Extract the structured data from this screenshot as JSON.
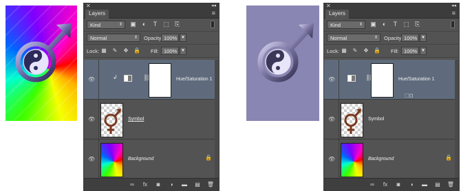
{
  "panels": [
    {
      "tab": "Layers",
      "kind_filter": "Kind",
      "blend_mode": "Normal",
      "opacity_label": "Opacity:",
      "opacity_value": "100%",
      "lock_label": "Lock:",
      "fill_label": "Fill:",
      "fill_value": "100%",
      "layers": [
        {
          "name": "Hue/Saturation 1",
          "type": "adjustment",
          "selected": true,
          "clipped": true
        },
        {
          "name": "Symbol",
          "type": "smart",
          "selected": false
        },
        {
          "name": "Background",
          "type": "background",
          "selected": false,
          "locked": true
        }
      ]
    },
    {
      "tab": "Layers",
      "kind_filter": "Kind",
      "blend_mode": "Normal",
      "opacity_label": "Opacity:",
      "opacity_value": "100%",
      "lock_label": "Lock:",
      "fill_label": "Fill:",
      "fill_value": "100%",
      "layers": [
        {
          "name": "Hue/Saturation 1",
          "type": "adjustment",
          "selected": true,
          "clipped": false
        },
        {
          "name": "Symbol",
          "type": "smart",
          "selected": false
        },
        {
          "name": "Background",
          "type": "background",
          "selected": false,
          "locked": true
        }
      ]
    }
  ],
  "icons": {
    "eye": "eye-icon",
    "link": "link-icon",
    "lock": "lock-icon",
    "footer": [
      "link-layers-icon",
      "fx-icon",
      "add-mask-icon",
      "adjustment-layer-icon",
      "new-group-icon",
      "new-layer-icon",
      "trash-icon"
    ]
  },
  "colors": {
    "panel_bg": "#535353",
    "selected_row": "#5f6b7c",
    "right_canvas": "#8a86b3"
  }
}
